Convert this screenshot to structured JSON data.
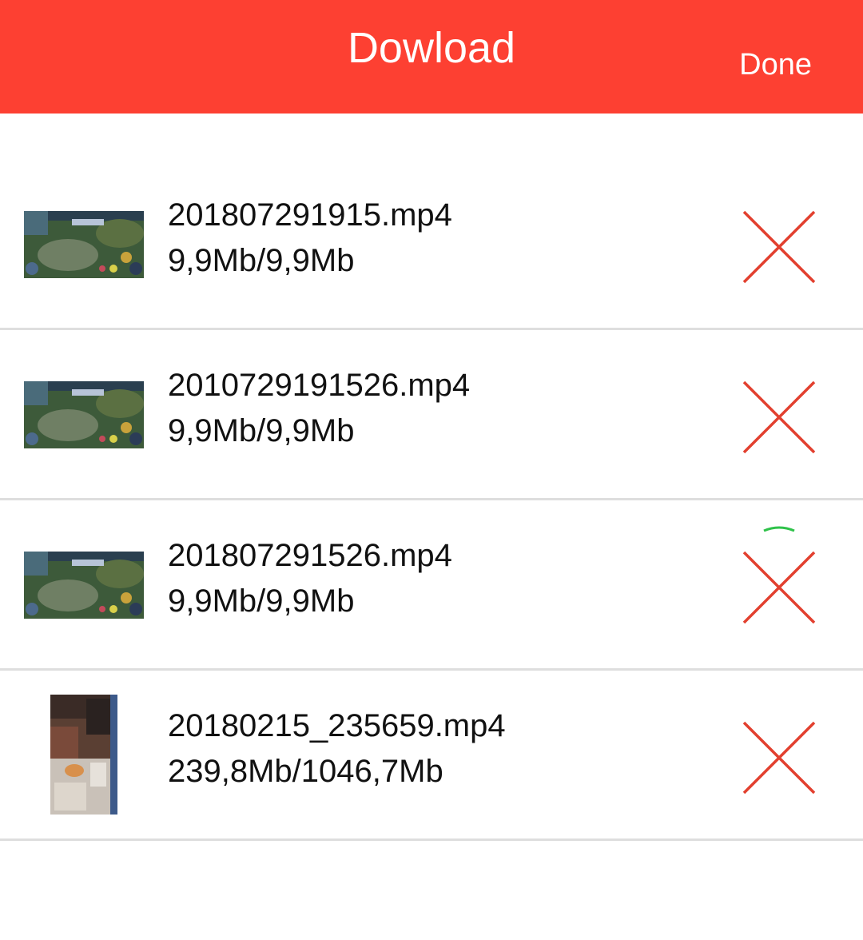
{
  "header": {
    "title": "Dowload",
    "done_label": "Done",
    "background_color": "#fd4032"
  },
  "downloads": [
    {
      "name": "201807291915.mp4",
      "size": "9,9Mb/9,9Mb",
      "thumbnail": "game-screenshot",
      "remove_icon": "close-x-icon"
    },
    {
      "name": "2010729191526.mp4",
      "size": "9,9Mb/9,9Mb",
      "thumbnail": "game-screenshot",
      "remove_icon": "close-x-icon"
    },
    {
      "name": "201807291526.mp4",
      "size": "9,9Mb/9,9Mb",
      "thumbnail": "game-screenshot",
      "remove_icon": "close-x-icon"
    },
    {
      "name": "20180215_235659.mp4",
      "size": "239,8Mb/1046,7Mb",
      "thumbnail": "room-photo",
      "remove_icon": "close-x-icon"
    }
  ],
  "colors": {
    "remove_icon": "#e2402f",
    "progress_arc": "#2fc24a",
    "divider": "#dedede"
  }
}
